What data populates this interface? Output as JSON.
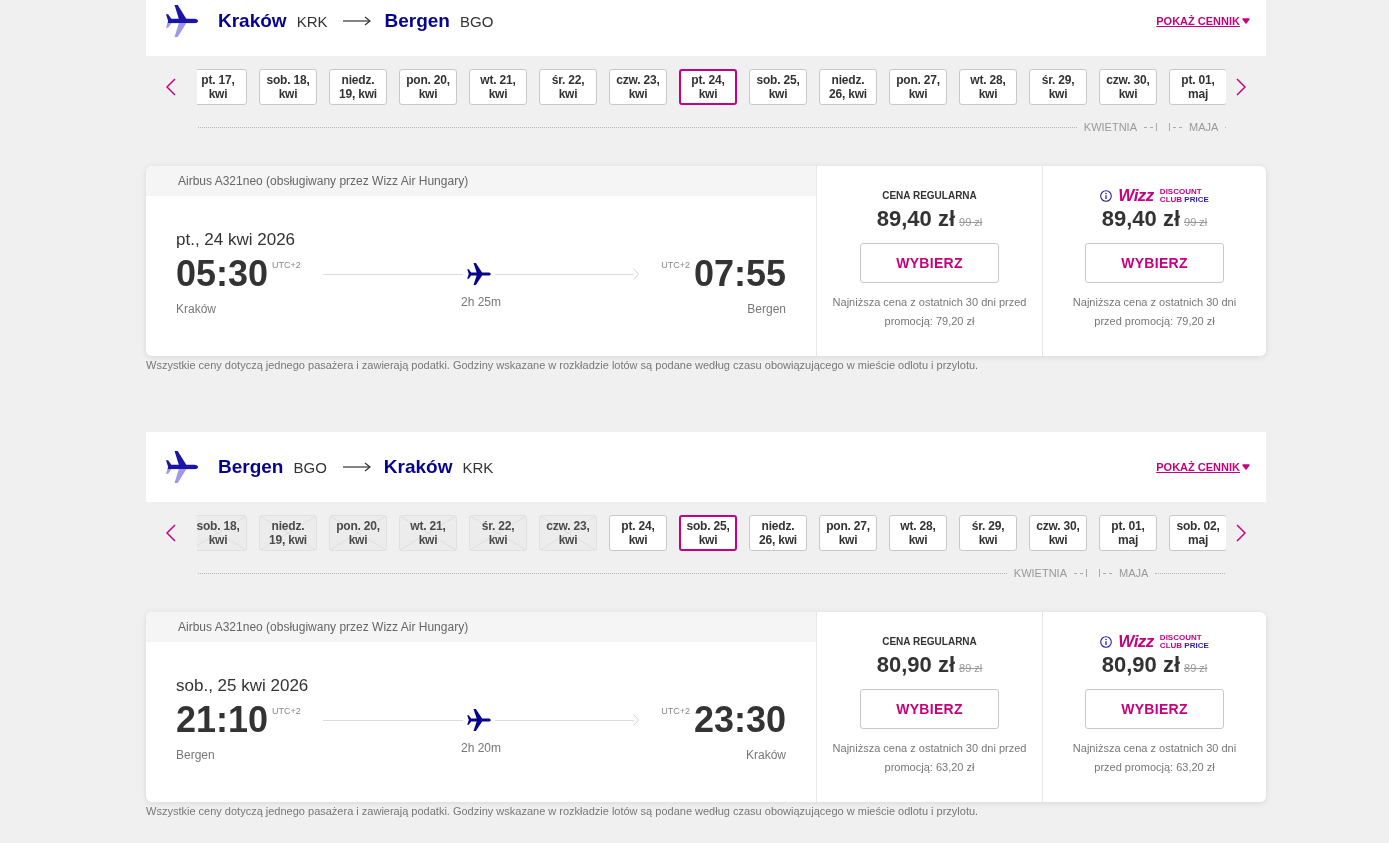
{
  "flights": [
    {
      "route": {
        "origin": {
          "city": "Kraków",
          "code": "KRK"
        },
        "destination": {
          "city": "Bergen",
          "code": "BGO"
        }
      },
      "price_list_link": "POKAŻ CENNIK",
      "months": [
        {
          "label": "KWIETNIA",
          "dates": [
            {
              "label": "pt. 17, kwi",
              "selected": false,
              "disabled": false
            },
            {
              "label": "sob. 18, kwi",
              "selected": false,
              "disabled": false
            },
            {
              "label": "niedz. 19, kwi",
              "selected": false,
              "disabled": false
            },
            {
              "label": "pon. 20, kwi",
              "selected": false,
              "disabled": false
            },
            {
              "label": "wt. 21, kwi",
              "selected": false,
              "disabled": false
            },
            {
              "label": "śr. 22, kwi",
              "selected": false,
              "disabled": false
            },
            {
              "label": "czw. 23, kwi",
              "selected": false,
              "disabled": false
            },
            {
              "label": "pt. 24, kwi",
              "selected": true,
              "disabled": false
            },
            {
              "label": "sob. 25, kwi",
              "selected": false,
              "disabled": false
            },
            {
              "label": "niedz. 26, kwi",
              "selected": false,
              "disabled": false
            },
            {
              "label": "pon. 27, kwi",
              "selected": false,
              "disabled": false
            },
            {
              "label": "wt. 28, kwi",
              "selected": false,
              "disabled": false
            },
            {
              "label": "śr. 29, kwi",
              "selected": false,
              "disabled": false
            },
            {
              "label": "czw. 30, kwi",
              "selected": false,
              "disabled": false
            }
          ]
        },
        {
          "label": "MAJA",
          "dates": [
            {
              "label": "pt. 01, maj",
              "selected": false,
              "disabled": false
            }
          ]
        }
      ],
      "card": {
        "aircraft": "Airbus A321neo (obsługiwany przez Wizz Air Hungary)",
        "date": "pt., 24 kwi 2026",
        "departure": {
          "time": "05:30",
          "utc": "UTC+2",
          "city": "Kraków"
        },
        "arrival": {
          "time": "07:55",
          "utc": "UTC+2",
          "city": "Bergen"
        },
        "duration": "2h 25m",
        "fares": [
          {
            "kind": "regular",
            "title": "CENA REGULARNA",
            "price": "89,40 zł",
            "old_price": "99 zł",
            "button": "WYBIERZ",
            "note": "Najniższa cena z ostatnich 30 dni przed promocją: 79,20 zł"
          },
          {
            "kind": "club",
            "logo": {
              "wordmark": "Wizz",
              "line_1": "DISCOUNT",
              "line_2": "CLUB",
              "line_2_accent": "PRICE"
            },
            "price": "89,40 zł",
            "old_price": "99 zł",
            "button": "WYBIERZ",
            "note": "Najniższa cena z ostatnich 30 dni przed promocją: 79,20 zł"
          }
        ]
      },
      "footnote": "Wszystkie ceny dotyczą jednego pasażera i zawierają podatki. Godziny wskazane w rozkładzie lotów są podane według czasu obowiązującego w mieście odlotu i przylotu."
    },
    {
      "route": {
        "origin": {
          "city": "Bergen",
          "code": "BGO"
        },
        "destination": {
          "city": "Kraków",
          "code": "KRK"
        }
      },
      "price_list_link": "POKAŻ CENNIK",
      "months": [
        {
          "label": "KWIETNIA",
          "dates": [
            {
              "label": "sob. 18, kwi",
              "selected": false,
              "disabled": true
            },
            {
              "label": "niedz. 19, kwi",
              "selected": false,
              "disabled": true
            },
            {
              "label": "pon. 20, kwi",
              "selected": false,
              "disabled": true
            },
            {
              "label": "wt. 21, kwi",
              "selected": false,
              "disabled": true
            },
            {
              "label": "śr. 22, kwi",
              "selected": false,
              "disabled": true
            },
            {
              "label": "czw. 23, kwi",
              "selected": false,
              "disabled": true
            },
            {
              "label": "pt. 24, kwi",
              "selected": false,
              "disabled": false
            },
            {
              "label": "sob. 25, kwi",
              "selected": true,
              "disabled": false
            },
            {
              "label": "niedz. 26, kwi",
              "selected": false,
              "disabled": false
            },
            {
              "label": "pon. 27, kwi",
              "selected": false,
              "disabled": false
            },
            {
              "label": "wt. 28, kwi",
              "selected": false,
              "disabled": false
            },
            {
              "label": "śr. 29, kwi",
              "selected": false,
              "disabled": false
            },
            {
              "label": "czw. 30, kwi",
              "selected": false,
              "disabled": false
            }
          ]
        },
        {
          "label": "MAJA",
          "dates": [
            {
              "label": "pt. 01, maj",
              "selected": false,
              "disabled": false
            },
            {
              "label": "sob. 02, maj",
              "selected": false,
              "disabled": false
            }
          ]
        }
      ],
      "card": {
        "aircraft": "Airbus A321neo (obsługiwany przez Wizz Air Hungary)",
        "date": "sob., 25 kwi 2026",
        "departure": {
          "time": "21:10",
          "utc": "UTC+2",
          "city": "Bergen"
        },
        "arrival": {
          "time": "23:30",
          "utc": "UTC+2",
          "city": "Kraków"
        },
        "duration": "2h 20m",
        "fares": [
          {
            "kind": "regular",
            "title": "CENA REGULARNA",
            "price": "80,90 zł",
            "old_price": "89 zł",
            "button": "WYBIERZ",
            "note": "Najniższa cena z ostatnich 30 dni przed promocją: 63,20 zł"
          },
          {
            "kind": "club",
            "logo": {
              "wordmark": "Wizz",
              "line_1": "DISCOUNT",
              "line_2": "CLUB",
              "line_2_accent": "PRICE"
            },
            "price": "80,90 zł",
            "old_price": "89 zł",
            "button": "WYBIERZ",
            "note": "Najniższa cena z ostatnich 30 dni przed promocją: 63,20 zł"
          }
        ]
      },
      "footnote": "Wszystkie ceny dotyczą jednego pasażera i zawierają podatki. Godziny wskazane w rozkładzie lotów są podane według czasu obowiązującego w mieście odlotu i przylotu."
    }
  ]
}
